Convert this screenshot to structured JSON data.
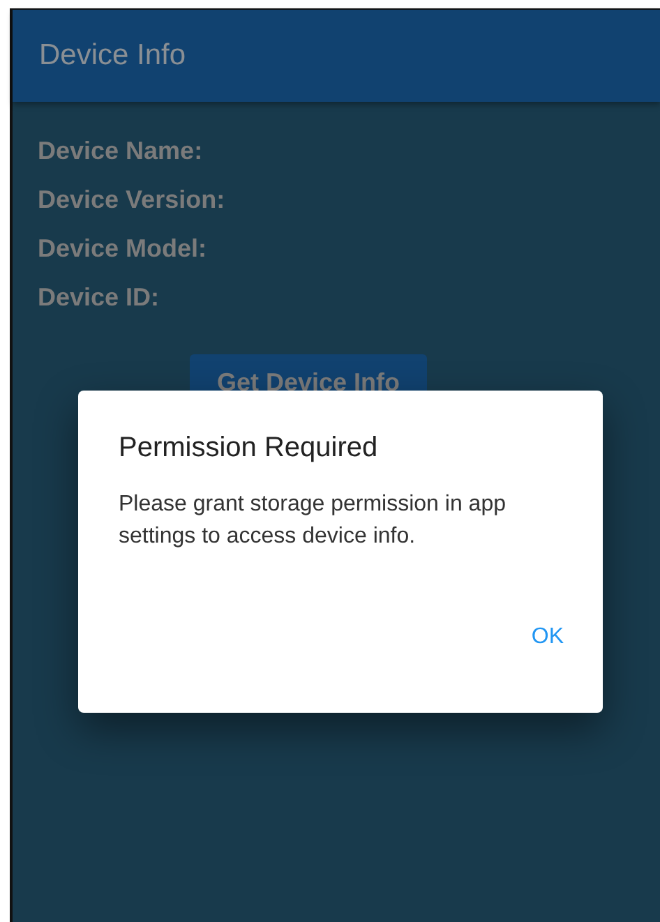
{
  "app_bar": {
    "title": "Device Info"
  },
  "fields": [
    {
      "label": "Device Name:"
    },
    {
      "label": "Device Version:"
    },
    {
      "label": "Device Model:"
    },
    {
      "label": "Device ID:"
    }
  ],
  "button": {
    "label": "Get Device Info"
  },
  "dialog": {
    "title": "Permission Required",
    "message": "Please grant storage permission in app settings to access device info.",
    "actions": [
      "OK"
    ]
  }
}
